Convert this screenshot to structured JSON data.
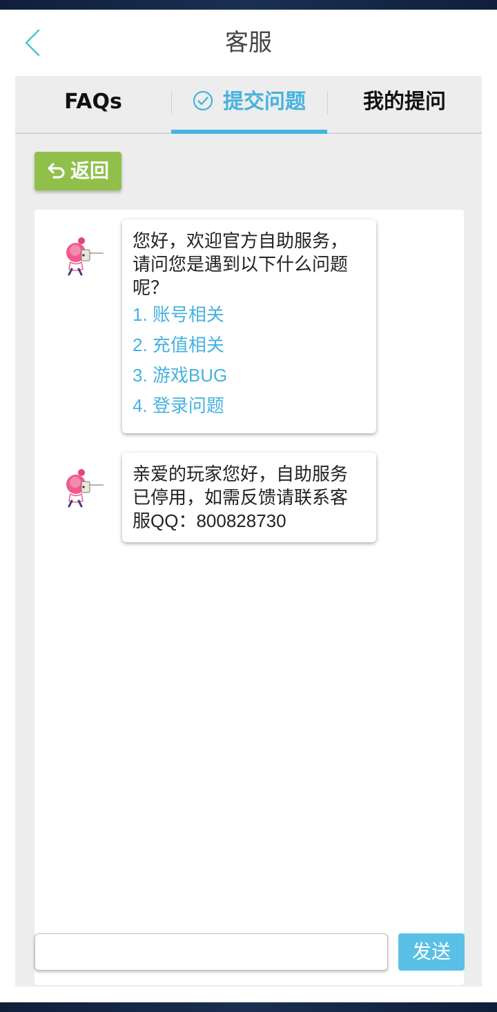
{
  "header": {
    "title": "客服"
  },
  "tabs": [
    {
      "label": "FAQs"
    },
    {
      "label": "提交问题"
    },
    {
      "label": "我的提问"
    }
  ],
  "back_action": {
    "label": "返回"
  },
  "messages": [
    {
      "text": "您好，欢迎官方自助服务，请问您是遇到以下什么问题呢？",
      "options": [
        "1. 账号相关",
        "2. 充值相关",
        "3. 游戏BUG",
        "4. 登录问题"
      ]
    },
    {
      "text": "亲爱的玩家您好，自助服务已停用，如需反馈请联系客服QQ：800828730"
    }
  ],
  "input": {
    "value": "",
    "placeholder": ""
  },
  "send_button": {
    "label": "发送"
  },
  "colors": {
    "accent": "#46b2de",
    "back_button": "#90c04a",
    "send_button": "#5bc0e6"
  },
  "icons": {
    "back": "chevron-left-icon",
    "tab_submit": "check-circle-icon",
    "return": "return-arrow-icon",
    "avatar": "pink-mascot-icon"
  }
}
